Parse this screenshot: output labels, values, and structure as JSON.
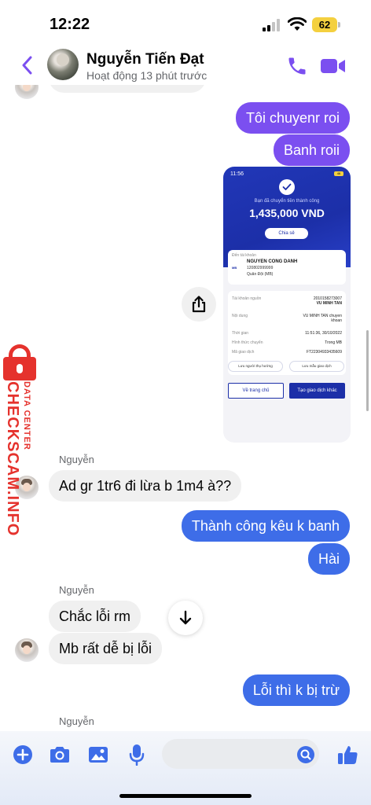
{
  "status_bar": {
    "time": "12:22",
    "battery": "62"
  },
  "header": {
    "contact_name": "Nguyễn Tiến Đạt",
    "status": "Hoạt động 13 phút trước"
  },
  "messages": {
    "out_1": "Tôi chuyenr roi",
    "out_2": "Banh roii",
    "sender_1": "Nguyễn",
    "in_1": "Ad gr 1tr6 đi lừa b 1m4 à??",
    "out_3": "Thành công kêu k banh",
    "out_4": "Hài",
    "sender_2": "Nguyễn",
    "in_2": "Chắc lỗi rm",
    "in_3": "Mb rất dễ bị lỗi",
    "out_5": "Lỗi thì k bị trừ",
    "sender_3": "Nguyễn"
  },
  "screenshot": {
    "time": "11:56",
    "battery": "46",
    "subtitle": "Bạn đã chuyển tiền thành công",
    "amount": "1,435,000 VND",
    "share_label": "Chia sẻ",
    "to_account_label": "Đến tài khoản",
    "bank_logo": "MB",
    "recipient_name": "NGUYEN CONG DANH",
    "recipient_account": "120802999999",
    "recipient_bank": "Quân Đội (MB)",
    "details": [
      {
        "label": "Tài khoản nguồn",
        "value": "2010158273007",
        "value2": "VU MINH TAN"
      },
      {
        "label": "Nội dung",
        "value": "VU MINH TAN chuyen",
        "value2": "khoan"
      },
      {
        "label": "Thời gian",
        "value": "11:51:36, 30/10/2022",
        "value2": ""
      },
      {
        "label": "Hình thức chuyển",
        "value": "Trong MB",
        "value2": ""
      },
      {
        "label": "Mã giao dịch",
        "value": "FT22304933435609",
        "value2": ""
      }
    ],
    "save_recipient": "Lưu người thụ hưởng",
    "save_template": "Lưu mẫu giao dịch",
    "home_button": "Về trang chủ",
    "new_transaction_button": "Tạo giao dịch khác"
  },
  "watermark": {
    "brand": "CHECKSCAM.INFO",
    "tag": "DATA CENTER"
  },
  "composer": {
    "placeholder": ""
  },
  "colors": {
    "accent_purple": "#7b4ff0",
    "accent_blue": "#3e6de8",
    "incoming_bubble": "#f0f0f0",
    "watermark_red": "#e5322d"
  },
  "icons": [
    "back-chevron-icon",
    "phone-icon",
    "video-camera-icon",
    "share-icon",
    "arrow-down-icon",
    "plus-icon",
    "camera-icon",
    "image-icon",
    "microphone-icon",
    "search-icon",
    "thumbs-up-icon"
  ]
}
